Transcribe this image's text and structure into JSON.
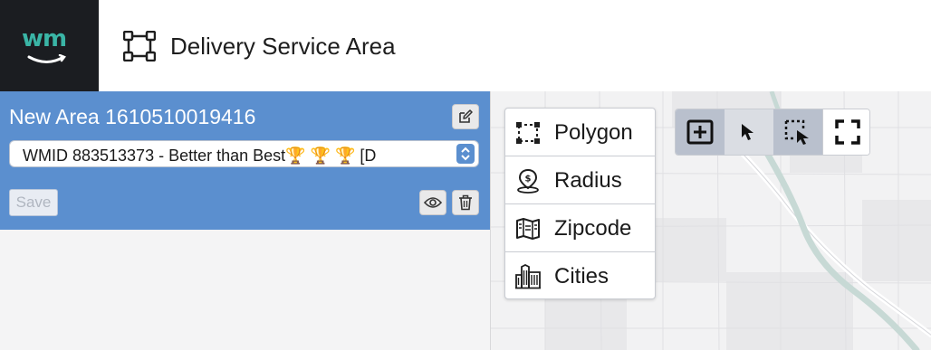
{
  "header": {
    "logo_text": "wm",
    "title": "Delivery Service Area"
  },
  "area": {
    "name": "New Area 1610510019416",
    "selected_option": "WMID 883513373 - Better than Best🏆 🏆 🏆 [D",
    "save_label": "Save"
  },
  "shape_menu": {
    "items": [
      {
        "label": "Polygon",
        "icon": "polygon-icon"
      },
      {
        "label": "Radius",
        "icon": "radius-icon"
      },
      {
        "label": "Zipcode",
        "icon": "zipcode-icon"
      },
      {
        "label": "Cities",
        "icon": "cities-icon"
      }
    ]
  },
  "map_tools": {
    "items": [
      {
        "icon": "add-box-icon",
        "active": true
      },
      {
        "icon": "pointer-icon",
        "active": true
      },
      {
        "icon": "area-select-icon",
        "active": true
      },
      {
        "icon": "fullscreen-icon",
        "active": false
      }
    ]
  },
  "colors": {
    "logo_bg": "#1b1d21",
    "logo_accent": "#3ab5a6",
    "panel_blue": "#5b8fcf",
    "tool_active": "#dfe2e7"
  }
}
